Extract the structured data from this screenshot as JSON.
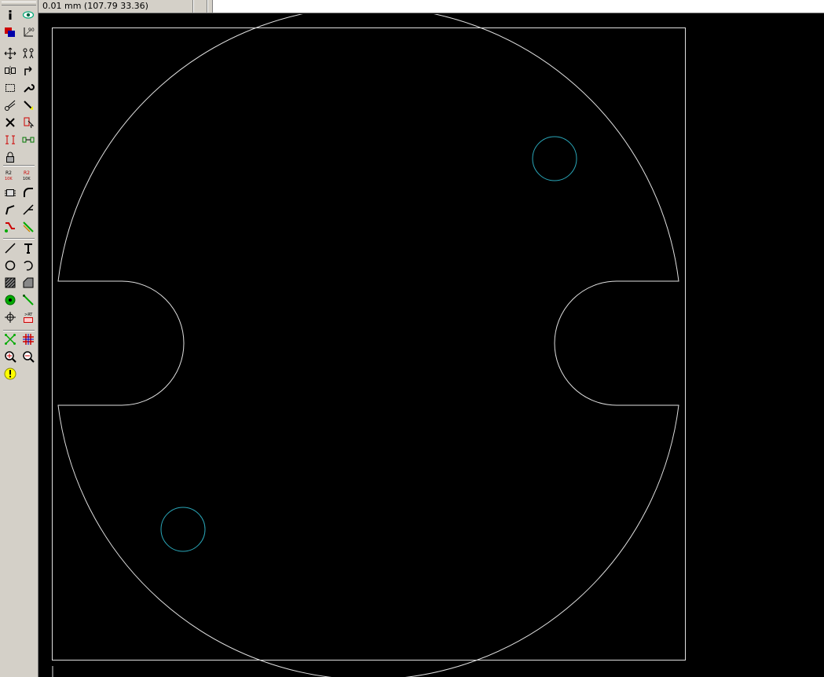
{
  "status": {
    "coordinates": "0.01 mm (107.79 33.36)"
  },
  "toolbar": {
    "tools": [
      {
        "name": "info-icon",
        "col": 0,
        "row": 0
      },
      {
        "name": "view-eye-icon",
        "col": 1,
        "row": 0
      },
      {
        "name": "layers-icon",
        "col": 0,
        "row": 1
      },
      {
        "name": "grid-angle-icon",
        "col": 1,
        "row": 1
      },
      {
        "name": "move-icon",
        "col": 0,
        "row": 2
      },
      {
        "name": "components-icon",
        "col": 1,
        "row": 2
      },
      {
        "name": "mirror-icon",
        "col": 0,
        "row": 3
      },
      {
        "name": "flip-icon",
        "col": 1,
        "row": 3
      },
      {
        "name": "select-rect-icon",
        "col": 0,
        "row": 4
      },
      {
        "name": "wrench-icon",
        "col": 1,
        "row": 4
      },
      {
        "name": "cut-icon",
        "col": 0,
        "row": 5
      },
      {
        "name": "highlight-pen-icon",
        "col": 1,
        "row": 5
      },
      {
        "name": "delete-icon",
        "col": 0,
        "row": 6
      },
      {
        "name": "select-component-icon",
        "col": 1,
        "row": 6
      },
      {
        "name": "measure-icon",
        "col": 0,
        "row": 7
      },
      {
        "name": "move-component-icon",
        "col": 1,
        "row": 7
      },
      {
        "name": "lock-icon",
        "col": 0,
        "row": 8
      },
      {
        "name": "component-value-icon",
        "col": 0,
        "row": 9
      },
      {
        "name": "component-value-alt-icon",
        "col": 1,
        "row": 9
      },
      {
        "name": "footprint-icon",
        "col": 0,
        "row": 10
      },
      {
        "name": "arc-track-icon",
        "col": 1,
        "row": 10
      },
      {
        "name": "route-bend-icon",
        "col": 0,
        "row": 11
      },
      {
        "name": "route-45-icon",
        "col": 1,
        "row": 11
      },
      {
        "name": "route-track-icon",
        "col": 0,
        "row": 12
      },
      {
        "name": "route-diff-icon",
        "col": 1,
        "row": 12
      },
      {
        "name": "draw-line-icon",
        "col": 0,
        "row": 13
      },
      {
        "name": "add-text-icon",
        "col": 1,
        "row": 13
      },
      {
        "name": "draw-circle-icon",
        "col": 0,
        "row": 14
      },
      {
        "name": "draw-arc-icon",
        "col": 1,
        "row": 14
      },
      {
        "name": "fill-zone-icon",
        "col": 0,
        "row": 15
      },
      {
        "name": "polygon-icon",
        "col": 1,
        "row": 15
      },
      {
        "name": "add-via-icon",
        "col": 0,
        "row": 16
      },
      {
        "name": "add-connection-icon",
        "col": 1,
        "row": 16
      },
      {
        "name": "target-icon",
        "col": 0,
        "row": 17
      },
      {
        "name": "dimension-icon",
        "col": 1,
        "row": 17
      },
      {
        "name": "ratsnest-icon",
        "col": 0,
        "row": 18
      },
      {
        "name": "grid-icon",
        "col": 1,
        "row": 18
      },
      {
        "name": "zoom-in-icon",
        "col": 0,
        "row": 19
      },
      {
        "name": "zoom-out-icon",
        "col": 1,
        "row": 19
      },
      {
        "name": "drc-warning-icon",
        "col": 0,
        "row": 20
      }
    ]
  },
  "colors": {
    "background": "#000000",
    "outline": "#e0e0e0",
    "holes": "#2aa6b8",
    "toolbar": "#d4d0c8"
  }
}
